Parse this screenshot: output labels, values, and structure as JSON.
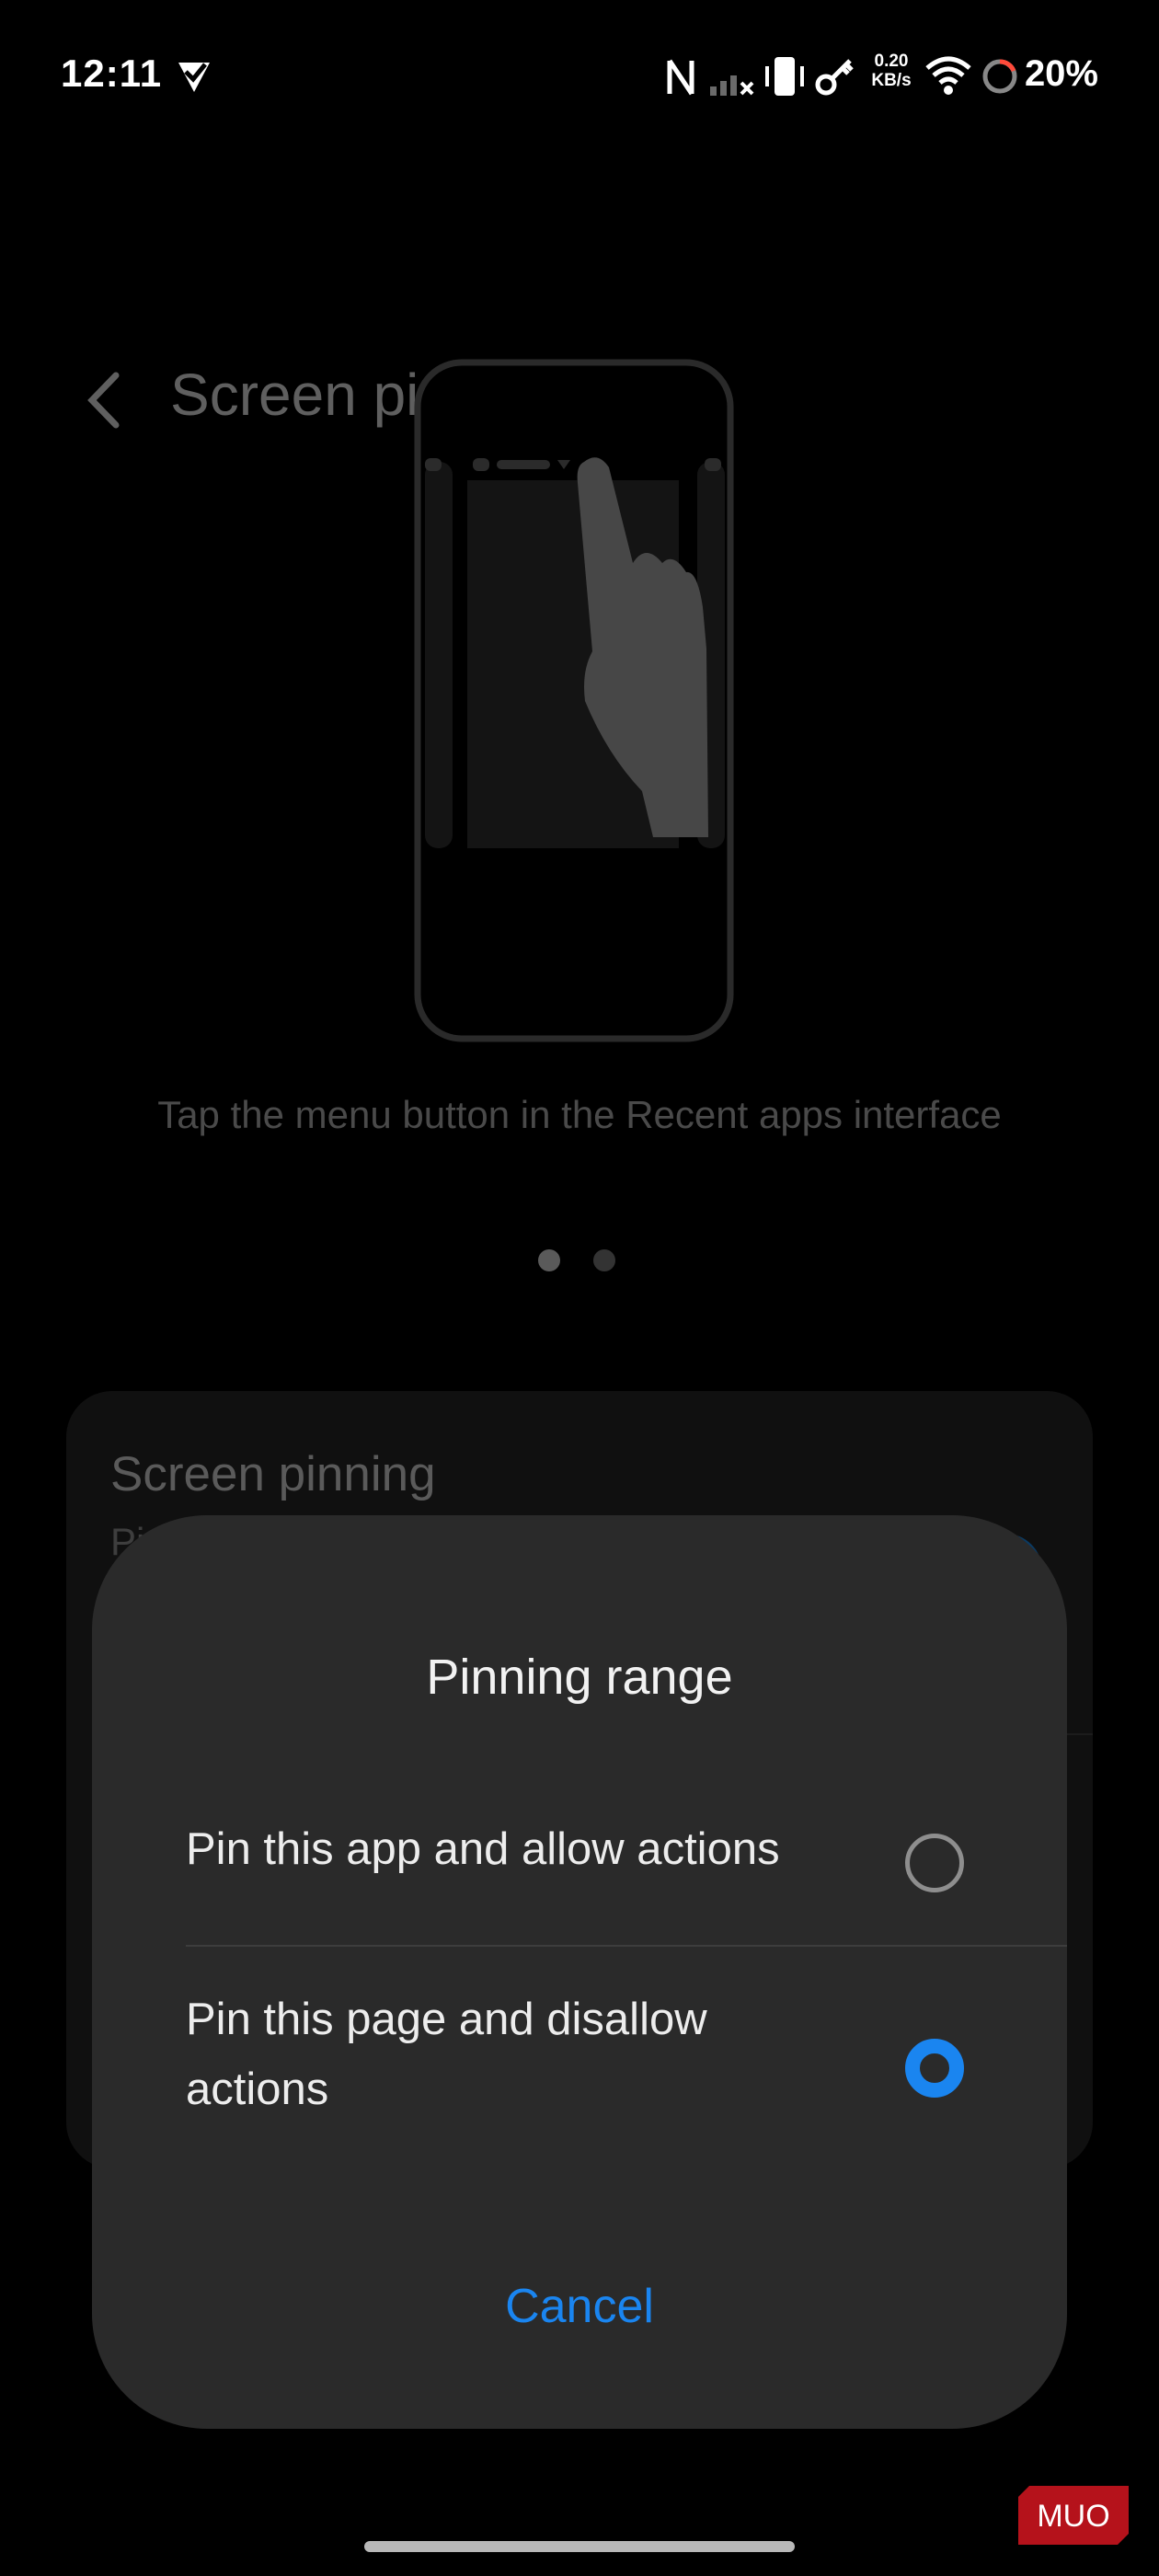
{
  "status_bar": {
    "time": "12:11",
    "network_speed_value": "0.20",
    "network_speed_unit": "KB/s",
    "battery": "20%"
  },
  "app_bar": {
    "title": "Screen pinning",
    "back_icon": "back-arrow-icon"
  },
  "tutorial": {
    "caption": "Tap the menu button in the Recent apps interface",
    "page_count": 2,
    "current_page": 1
  },
  "settings_card": {
    "title": "Screen pinning",
    "subtitle_visible": "Pi"
  },
  "dialog": {
    "title": "Pinning range",
    "options": [
      {
        "label": "Pin this app and allow actions",
        "selected": false
      },
      {
        "label": "Pin this page and disallow actions",
        "selected": true
      }
    ],
    "cancel_label": "Cancel"
  },
  "watermark": "MUO",
  "colors": {
    "accent": "#1a85f0",
    "dialog_bg": "#2a2a2a",
    "background": "#000000"
  }
}
